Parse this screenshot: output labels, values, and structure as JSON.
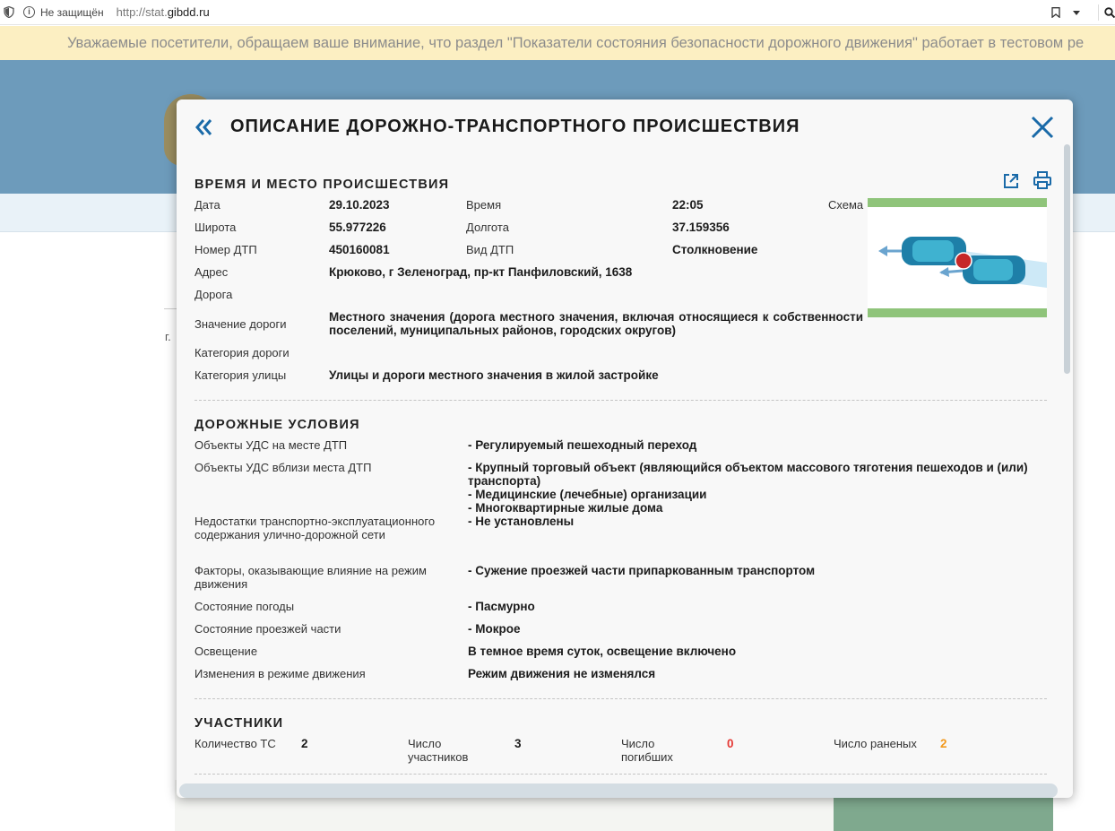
{
  "browser": {
    "security_label": "Не защищён",
    "url_prefix": "http://stat.",
    "url_domain": "gibdd.ru"
  },
  "notice": {
    "text": "Уважаемые посетители, обращаем ваше внимание, что раздел \"Показатели состояния безопасности дорожного движения\" работает в тестовом ре"
  },
  "background": {
    "side_text": "г."
  },
  "modal": {
    "title": "ОПИСАНИЕ ДОРОЖНО-ТРАНСПОРТНОГО ПРОИСШЕСТВИЯ",
    "time_place": {
      "title": "ВРЕМЯ И МЕСТО ПРОИСШЕСТВИЯ",
      "date_label": "Дата",
      "date_value": "29.10.2023",
      "time_label": "Время",
      "time_value": "22:05",
      "scheme_label": "Схема",
      "lat_label": "Широта",
      "lat_value": "55.977226",
      "lon_label": "Долгота",
      "lon_value": "37.159356",
      "number_label": "Номер ДТП",
      "number_value": "450160081",
      "type_label": "Вид ДТП",
      "type_value": "Столкновение",
      "address_label": "Адрес",
      "address_value": "Крюково, г Зеленоград, пр-кт Панфиловский, 1638",
      "road_label": "Дорога",
      "road_value": "",
      "road_meaning_label": "Значение дороги",
      "road_meaning_value": "Местного значения (дорога местного значения, включая относящиеся к собственности поселений, муниципальных районов, городских округов)",
      "road_category_label": "Категория дороги",
      "road_category_value": "",
      "street_category_label": "Категория улицы",
      "street_category_value": "Улицы и дороги местного значения в жилой застройке"
    },
    "road_conditions": {
      "title": "ДОРОЖНЫЕ УСЛОВИЯ",
      "objects_at_label": "Объекты УДС на месте ДТП",
      "objects_at_value": "- Регулируемый пешеходный переход",
      "objects_near_label": "Объекты УДС вблизи места ДТП",
      "objects_near_values": [
        "- Крупный торговый объект (являющийся объектом массового тяготения пешеходов и (или) транспорта)",
        "- Медицинские (лечебные) организации",
        "- Многоквартирные жилые дома"
      ],
      "defects_label": "Недостатки транспортно-эксплуатационного содержания улично-дорожной сети",
      "defects_value": "- Не установлены",
      "factors_label": "Факторы, оказывающие влияние на режим движения",
      "factors_value": "- Сужение проезжей части припаркованным транспортом",
      "weather_label": "Состояние погоды",
      "weather_value": "- Пасмурно",
      "surface_label": "Состояние проезжей части",
      "surface_value": "- Мокрое",
      "lighting_label": "Освещение",
      "lighting_value": "В темное время суток, освещение включено",
      "regime_label": "Изменения в режиме движения",
      "regime_value": "Режим движения не изменялся"
    },
    "participants": {
      "title": "УЧАСТНИКИ",
      "vehicles_label": "Количество ТС",
      "vehicles_value": "2",
      "participants_label": "Число участников",
      "participants_value": "3",
      "killed_label": "Число погибших",
      "killed_value": "0",
      "injured_label": "Число раненых",
      "injured_value": "2"
    }
  },
  "colors": {
    "accent": "#1a6aa8",
    "killed": "#e53935",
    "injured": "#f29a1f",
    "notice_bg": "#fcefc2",
    "header_bg": "#6d9bbb"
  },
  "icons": [
    "shield-icon",
    "info-icon",
    "bookmark-icon",
    "dropdown-icon",
    "search-icon",
    "double-chevron-left-icon",
    "close-icon",
    "external-link-icon",
    "print-icon"
  ]
}
